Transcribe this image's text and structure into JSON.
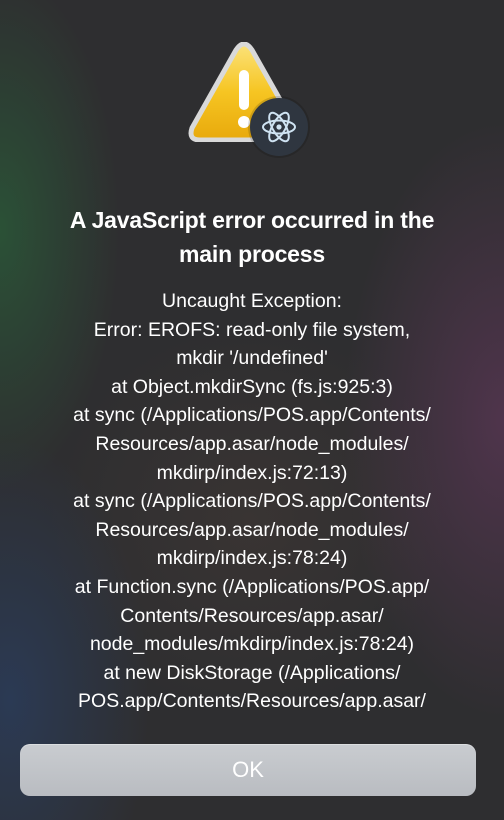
{
  "dialog": {
    "title_lines": [
      "A JavaScript error occurred in the",
      "main process"
    ],
    "message_lines": [
      "Uncaught Exception:",
      "Error: EROFS: read-only file system,",
      "mkdir '/undefined'",
      "at Object.mkdirSync (fs.js:925:3)",
      "at sync (/Applications/POS.app/Contents/",
      "Resources/app.asar/node_modules/",
      "mkdirp/index.js:72:13)",
      "at sync (/Applications/POS.app/Contents/",
      "Resources/app.asar/node_modules/",
      "mkdirp/index.js:78:24)",
      "at Function.sync (/Applications/POS.app/",
      "Contents/Resources/app.asar/",
      "node_modules/mkdirp/index.js:78:24)",
      "at new DiskStorage (/Applications/",
      "POS.app/Contents/Resources/app.asar/"
    ],
    "ok_label": "OK",
    "icons": {
      "main": "warning-icon",
      "badge": "electron-icon"
    },
    "colors": {
      "warning_fill": "#f5c518",
      "button": "#c4c7cc"
    }
  }
}
